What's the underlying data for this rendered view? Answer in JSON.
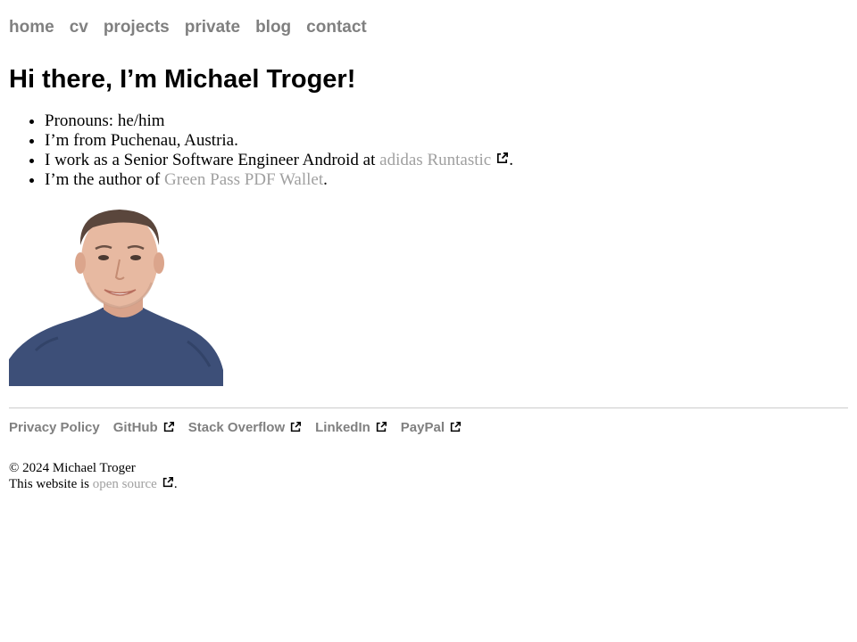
{
  "nav": {
    "items": [
      {
        "label": "home"
      },
      {
        "label": "cv"
      },
      {
        "label": "projects"
      },
      {
        "label": "private"
      },
      {
        "label": "blog"
      },
      {
        "label": "contact"
      }
    ]
  },
  "intro": {
    "title": "Hi there, I’m Michael Troger!",
    "pronouns": "Pronouns: he/him",
    "origin": "I’m from Puchenau, Austria.",
    "work_prefix": "I work as a Senior Software Engineer Android at ",
    "work_link": "adidas Runtastic",
    "work_suffix": ".",
    "author_prefix": "I’m the author of ",
    "author_link": "Green Pass PDF Wallet",
    "author_suffix": "."
  },
  "portrait": {
    "icon": "portrait-photo",
    "alt": "Michael Troger"
  },
  "footer": {
    "links": {
      "privacy": "Privacy Policy",
      "github": "GitHub",
      "stackoverflow": "Stack Overflow",
      "linkedin": "LinkedIn",
      "paypal": "PayPal"
    },
    "copyright": "© 2024 Michael Troger",
    "source_prefix": "This website is ",
    "source_link": "open source",
    "source_suffix": "."
  },
  "colors": {
    "nav_link": "#808080",
    "inline_link": "#a0a0a0",
    "divider": "#cccccc",
    "text": "#000000"
  },
  "icons": {
    "external": "external-link-icon"
  }
}
